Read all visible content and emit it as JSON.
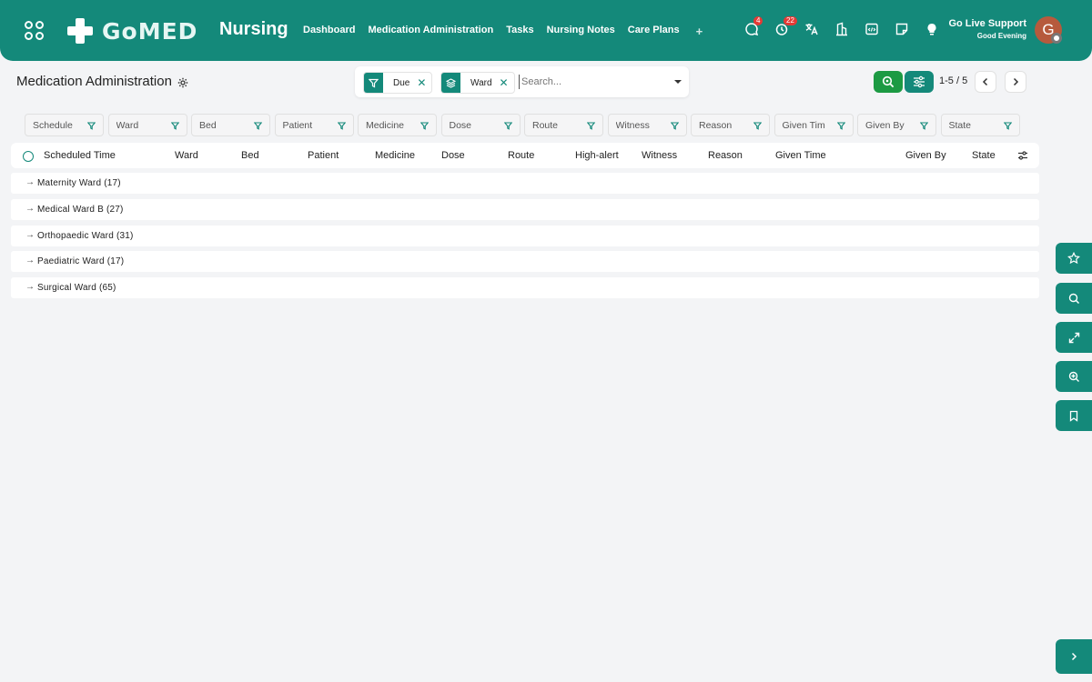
{
  "header": {
    "logo_text": "GoMED",
    "module": "Nursing",
    "nav": [
      "Dashboard",
      "Medication Administration",
      "Tasks",
      "Nursing Notes",
      "Care Plans"
    ],
    "nav_add": "+",
    "messages_badge": "4",
    "activity_badge": "22",
    "support_title": "Go Live Support",
    "support_subtitle": "Good Evening",
    "avatar_initial": "G"
  },
  "page": {
    "title": "Medication Administration"
  },
  "search": {
    "facets": [
      "Due",
      "Ward"
    ],
    "placeholder": "Search..."
  },
  "pager": {
    "text": "1-5 / 5"
  },
  "filters": [
    "Schedule",
    "Ward",
    "Bed",
    "Patient",
    "Medicine",
    "Dose",
    "Route",
    "Witness",
    "Reason",
    "Given Tim",
    "Given By",
    "State"
  ],
  "columns": [
    "Scheduled Time",
    "Ward",
    "Bed",
    "Patient",
    "Medicine",
    "Dose",
    "Route",
    "High-alert",
    "Witness",
    "Reason",
    "Given Time",
    "Given By",
    "State"
  ],
  "groups": [
    "Maternity Ward (17)",
    "Medical Ward B (27)",
    "Orthopaedic Ward (31)",
    "Paediatric Ward (17)",
    "Surgical Ward (65)"
  ],
  "colors": {
    "brand": "#14897a",
    "accent_green": "#1c9a43",
    "badge": "#e53935"
  }
}
